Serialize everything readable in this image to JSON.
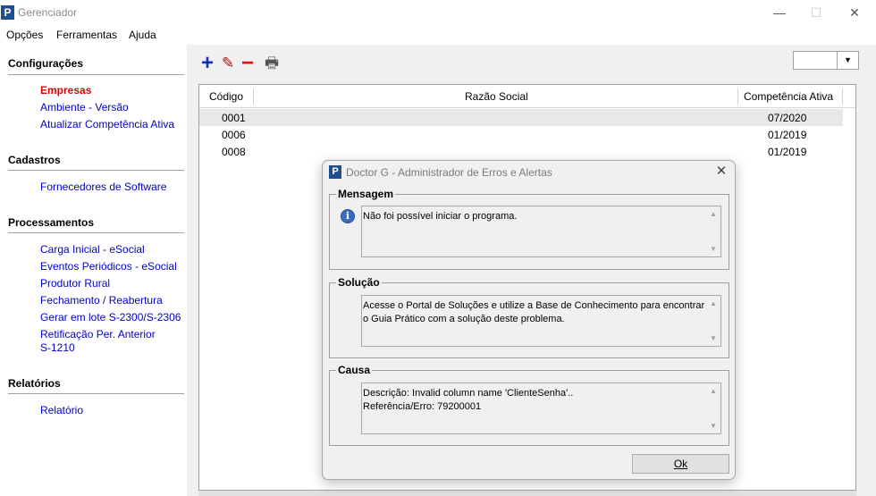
{
  "window": {
    "title": "Gerenciador",
    "logo": "P",
    "minimize": "—",
    "maximize": "☐",
    "close": "✕"
  },
  "menu": [
    "Opções",
    "Ferramentas",
    "Ajuda"
  ],
  "sidebar": {
    "sections": [
      {
        "title": "Configurações",
        "items": [
          "Empresas",
          "Ambiente - Versão",
          "Atualizar Competência Ativa"
        ]
      },
      {
        "title": "Cadastros",
        "items": [
          "Fornecedores de Software"
        ]
      },
      {
        "title": "Processamentos",
        "items": [
          "Carga Inicial - eSocial",
          "Eventos Periódicos - eSocial",
          "Produtor Rural",
          "Fechamento / Reabertura",
          "Gerar em lote S-2300/S-2306",
          "Retificação Per. Anterior\nS-1210"
        ]
      },
      {
        "title": "Relatórios",
        "items": [
          "Relatório"
        ]
      }
    ]
  },
  "toolbar": {
    "add_icon": "+",
    "edit_icon": "✎",
    "remove_icon": "−",
    "print_icon": "🖶",
    "combo_value": "",
    "combo_arrow": "▼"
  },
  "grid": {
    "headers": [
      "Código",
      "Razão Social",
      "Competência Ativa"
    ],
    "rows": [
      {
        "codigo": "0001",
        "razao": "",
        "competencia": "07/2020"
      },
      {
        "codigo": "0006",
        "razao": "",
        "competencia": "01/2019"
      },
      {
        "codigo": "0008",
        "razao": "",
        "competencia": "01/2019"
      }
    ]
  },
  "dialog": {
    "title": "Doctor G - Administrador de Erros e Alertas",
    "logo": "P",
    "close": "✕",
    "mensagem_label": "Mensagem",
    "mensagem_text": "Não foi possível iniciar o programa.",
    "info_icon": "i",
    "solucao_label": "Solução",
    "solucao_text": "Acesse o Portal de Soluções e utilize a Base de Conhecimento para encontrar o Guia Prático com a solução deste problema.",
    "causa_label": "Causa",
    "causa_text": "Descrição: Invalid column name 'ClienteSenha'..\nReferência/Erro: 79200001",
    "scroll_up": "▲",
    "scroll_down": "▼",
    "ok_label": "Ok"
  }
}
